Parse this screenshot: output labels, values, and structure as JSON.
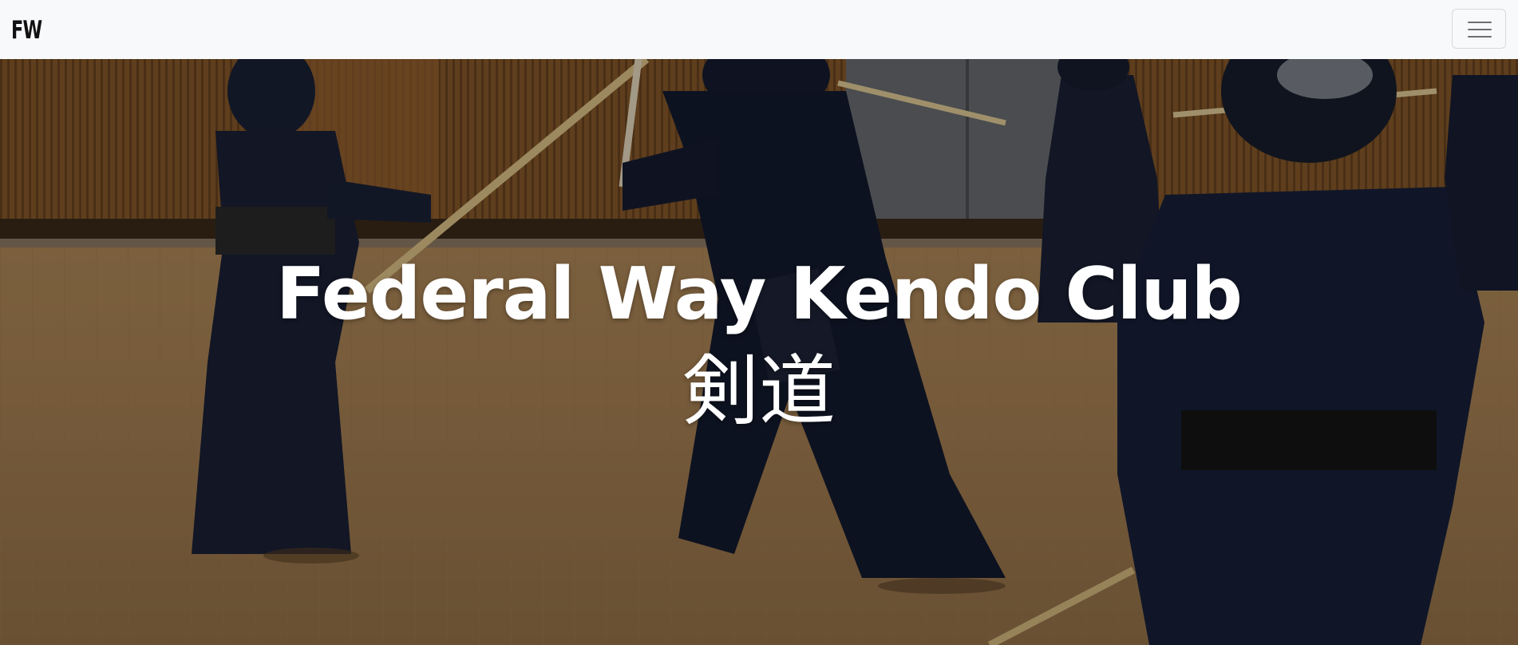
{
  "navbar": {
    "brand": "FW",
    "toggler_icon": "hamburger-menu-icon"
  },
  "hero": {
    "title": "Federal Way Kendo Club",
    "subtitle": "剣道",
    "background_image": "kendo-practice-photo"
  },
  "colors": {
    "navbar_bg": "#f8f9fa",
    "brand_text": "#111111",
    "hero_text": "#ffffff",
    "toggler_border": "#d7d9db",
    "toggler_icon": "#6c6f73"
  }
}
